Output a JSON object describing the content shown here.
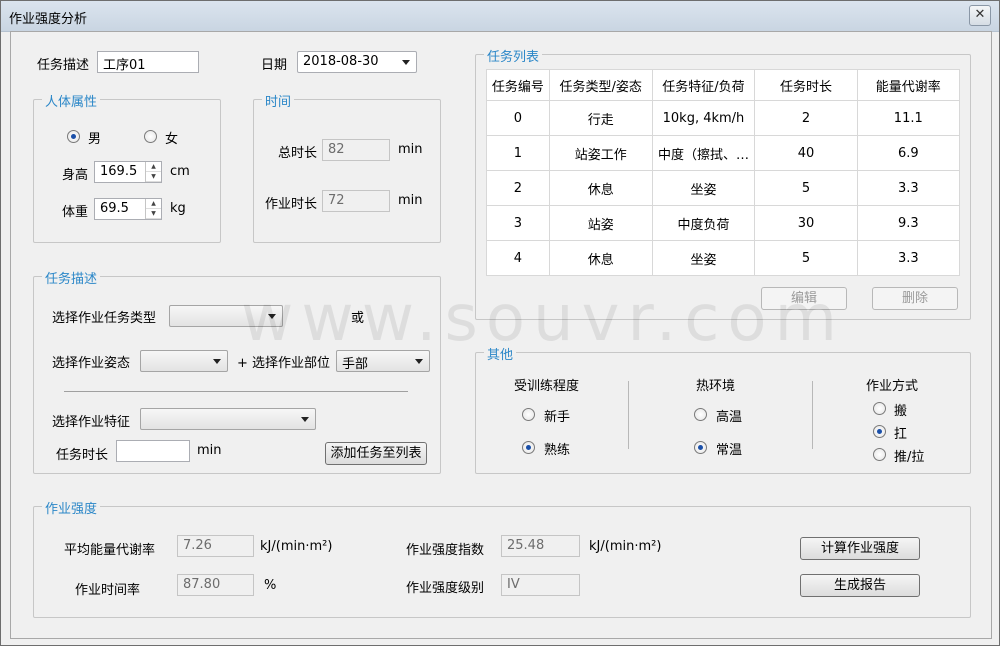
{
  "window": {
    "title": "作业强度分析",
    "close": "✕"
  },
  "task_info": {
    "desc_label": "任务描述",
    "desc_value": "工序01",
    "date_label": "日期",
    "date_value": "2018-08-30"
  },
  "body_attr": {
    "title": "人体属性",
    "male": "男",
    "female": "女",
    "gender_selected": "male",
    "height_label": "身高",
    "height_value": "169.5",
    "height_unit": "cm",
    "weight_label": "体重",
    "weight_value": "69.5",
    "weight_unit": "kg"
  },
  "time": {
    "title": "时间",
    "total_label": "总时长",
    "total_value": "82",
    "total_unit": "min",
    "work_label": "作业时长",
    "work_value": "72",
    "work_unit": "min"
  },
  "task_desc": {
    "title": "任务描述",
    "type_label": "选择作业任务类型",
    "or_label": "或",
    "posture_label": "选择作业姿态",
    "plus_label": "+ 选择作业部位",
    "part_value": "手部",
    "feature_label": "选择作业特征",
    "duration_label": "任务时长",
    "duration_unit": "min",
    "add_button": "添加任务至列表"
  },
  "task_list": {
    "title": "任务列表",
    "columns": [
      "任务编号",
      "任务类型/姿态",
      "任务特征/负荷",
      "任务时长",
      "能量代谢率"
    ],
    "rows": [
      [
        "0",
        "行走",
        "10kg, 4km/h",
        "2",
        "11.1"
      ],
      [
        "1",
        "站姿工作",
        "中度（擦拭、…",
        "40",
        "6.9"
      ],
      [
        "2",
        "休息",
        "坐姿",
        "5",
        "3.3"
      ],
      [
        "3",
        "站姿",
        "中度负荷",
        "30",
        "9.3"
      ],
      [
        "4",
        "休息",
        "坐姿",
        "5",
        "3.3"
      ]
    ],
    "edit_button": "编辑",
    "delete_button": "删除"
  },
  "other": {
    "title": "其他",
    "training_label": "受训练程度",
    "novice": "新手",
    "skilled": "熟练",
    "training_selected": "skilled",
    "thermal_label": "热环境",
    "high_temp": "高温",
    "normal_temp": "常温",
    "thermal_selected": "normal",
    "mode_label": "作业方式",
    "carry": "搬",
    "lift": "扛",
    "push_pull": "推/拉",
    "mode_selected": "lift"
  },
  "intensity": {
    "title": "作业强度",
    "avg_label": "平均能量代谢率",
    "avg_value": "7.26",
    "avg_unit": "kJ/(min·m²)",
    "ratio_label": "作业时间率",
    "ratio_value": "87.80",
    "ratio_unit": "%",
    "index_label": "作业强度指数",
    "index_value": "25.48",
    "index_unit": "kJ/(min·m²)",
    "level_label": "作业强度级别",
    "level_value": "IV",
    "calc_button": "计算作业强度",
    "report_button": "生成报告"
  },
  "watermark": "www.souvr.com"
}
